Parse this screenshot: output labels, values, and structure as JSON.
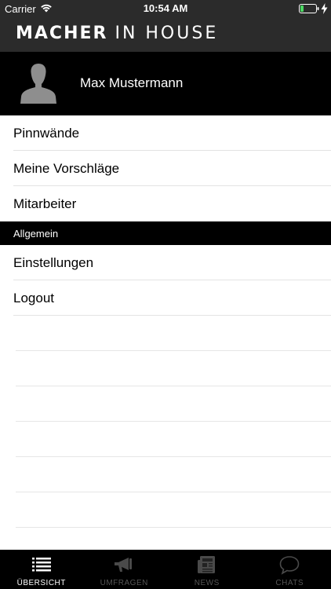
{
  "status_bar": {
    "carrier": "Carrier",
    "time": "10:54 AM"
  },
  "brand": {
    "bold": "MACHER",
    "light": "IN HOUSE"
  },
  "profile": {
    "name": "Max Mustermann"
  },
  "menu": {
    "items": [
      {
        "label": "Pinnwände"
      },
      {
        "label": "Meine Vorschläge"
      },
      {
        "label": "Mitarbeiter"
      }
    ],
    "section_header": "Allgemein",
    "general_items": [
      {
        "label": "Einstellungen"
      },
      {
        "label": "Logout"
      }
    ]
  },
  "tabs": [
    {
      "label": "ÜBERSICHT",
      "icon": "list-icon",
      "active": true
    },
    {
      "label": "UMFRAGEN",
      "icon": "megaphone-icon",
      "active": false
    },
    {
      "label": "NEWS",
      "icon": "newspaper-icon",
      "active": false
    },
    {
      "label": "CHATS",
      "icon": "chat-bubble-icon",
      "active": false
    }
  ],
  "colors": {
    "header": "#2b2b2b",
    "profile_bg": "#000000",
    "battery_fill": "#4cd964",
    "tab_active": "#ffffff",
    "tab_inactive": "#555555"
  }
}
